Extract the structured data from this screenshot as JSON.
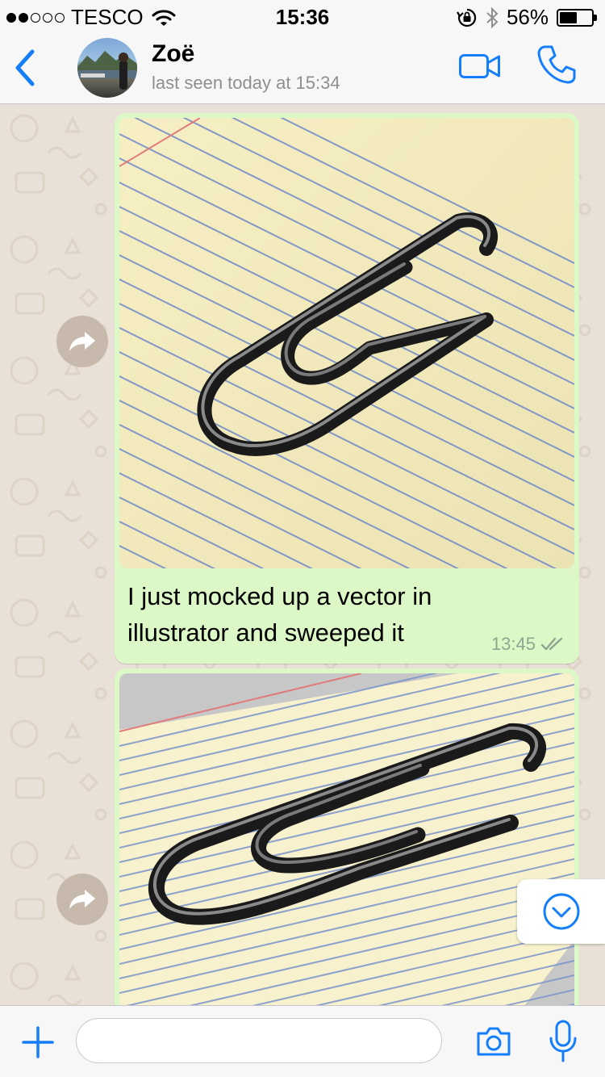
{
  "status_bar": {
    "carrier": "TESCO",
    "signal_bars_filled": 2,
    "signal_bars_total": 5,
    "time": "15:36",
    "battery_percent": "56%",
    "battery_level": 0.56
  },
  "header": {
    "back_icon": "chevron-left-icon",
    "contact_name": "Zoë",
    "last_seen": "last seen today at 15:34",
    "video_icon": "video-camera-icon",
    "phone_icon": "phone-icon"
  },
  "messages": [
    {
      "type": "image",
      "image_subject": "paperclip-render",
      "caption": "I just mocked up a vector in illustrator and sweeped it",
      "time": "13:45",
      "status_icon": "double-check-icon"
    },
    {
      "type": "image",
      "image_subject": "paperclip-render"
    }
  ],
  "input_bar": {
    "placeholder": "",
    "attach_icon": "plus-icon",
    "camera_icon": "camera-icon",
    "mic_icon": "microphone-icon"
  },
  "colors": {
    "accent": "#147efb",
    "outgoing_bubble": "#dcf8c6",
    "chat_background": "#e9e1d7",
    "bar_background": "#f7f7f7"
  }
}
